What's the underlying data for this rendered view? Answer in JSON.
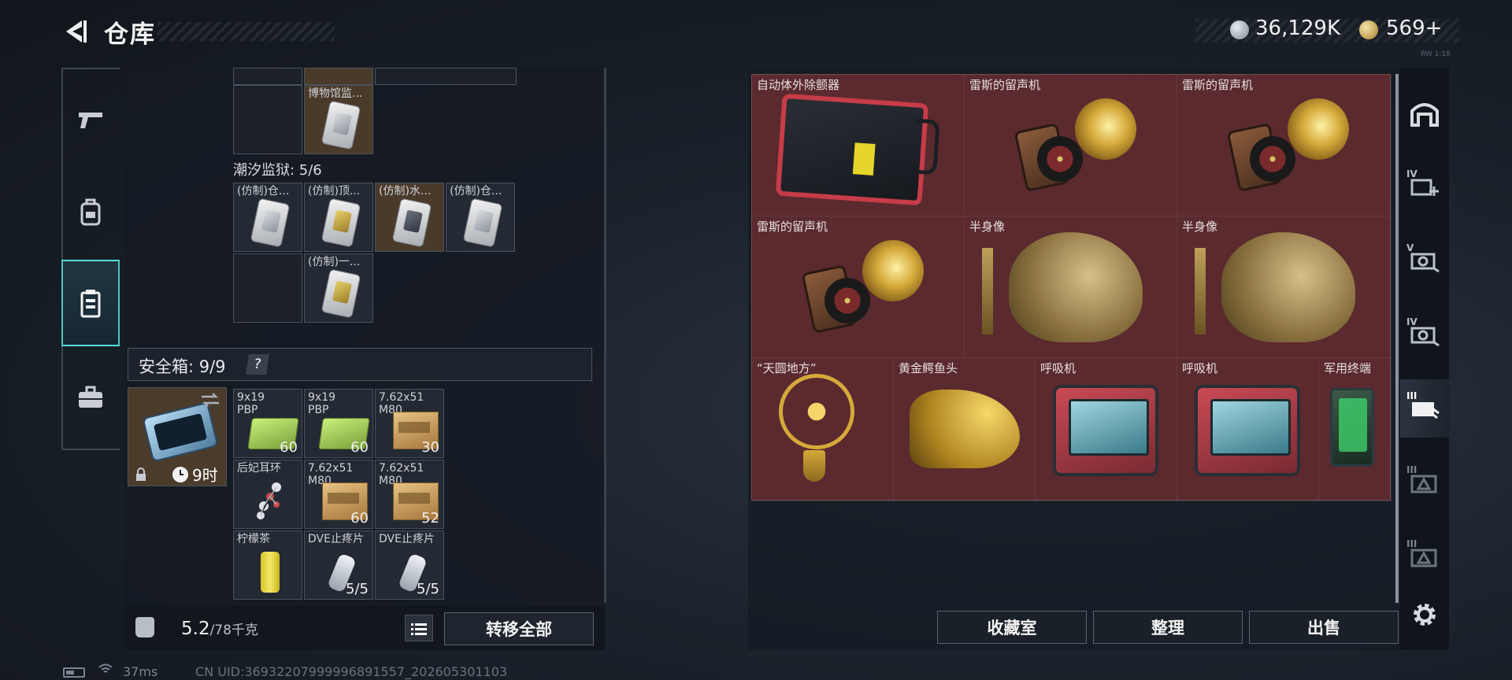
{
  "header": {
    "title": "仓库",
    "currency": "36,129K",
    "premium": "569+",
    "corner_tag": "RW 1:18"
  },
  "left_tabs": [
    {
      "name": "weapons",
      "icon": "pistol-icon"
    },
    {
      "name": "gear",
      "icon": "backpack-icon"
    },
    {
      "name": "storage",
      "icon": "locker-icon",
      "active": true
    },
    {
      "name": "case",
      "icon": "briefcase-icon"
    }
  ],
  "storage": {
    "top_row_labels": [
      "",
      "",
      ""
    ],
    "museum_item": "博物馆监...",
    "prison_label": "潮汐监狱: 5/6",
    "prison_items": [
      "(仿制)仓...",
      "(仿制)顶...",
      "(仿制)水...",
      "(仿制)仓...",
      "(仿制)一..."
    ]
  },
  "safe": {
    "label": "安全箱: 9/9",
    "help": "?",
    "timer": "9时",
    "items": [
      {
        "label": "9x19\nPBP",
        "count": "60"
      },
      {
        "label": "9x19\nPBP",
        "count": "60"
      },
      {
        "label": "7.62x51\nM80",
        "count": "30"
      },
      {
        "label": "后妃耳环",
        "count": ""
      },
      {
        "label": "7.62x51\nM80",
        "count": "60"
      },
      {
        "label": "7.62x51\nM80",
        "count": "52"
      },
      {
        "label": "柠檬茶",
        "count": ""
      },
      {
        "label": "DVE止疼片",
        "count": "5/5"
      },
      {
        "label": "DVE止疼片",
        "count": "5/5"
      }
    ]
  },
  "weight": {
    "current": "5.2",
    "max": "/78千克"
  },
  "buttons": {
    "transfer_all": "转移全部",
    "collection_room": "收藏室",
    "organize": "整理",
    "sell": "出售"
  },
  "collection": {
    "row1": [
      "自动体外除颤器",
      "雷斯的留声机",
      "雷斯的留声机"
    ],
    "row2": [
      "雷斯的留声机",
      "半身像",
      "半身像"
    ],
    "row3": [
      "“天圆地方”",
      "黄金鳄鱼头",
      "呼吸机",
      "呼吸机",
      "军用终端"
    ]
  },
  "right_tabs": [
    {
      "roman": "",
      "icon": "home-arch-icon"
    },
    {
      "roman": "IV",
      "icon": "medkit-plus-icon"
    },
    {
      "roman": "V",
      "icon": "camera-tool-icon"
    },
    {
      "roman": "IV",
      "icon": "camera-tool-icon"
    },
    {
      "roman": "III",
      "icon": "card-hand-icon",
      "active": true
    },
    {
      "roman": "III",
      "icon": "triangle-box-icon"
    },
    {
      "roman": "III",
      "icon": "triangle-box-icon"
    }
  ],
  "status": {
    "ping": "37ms",
    "uid": "CN UID:36932207999996891557_202605301103"
  }
}
